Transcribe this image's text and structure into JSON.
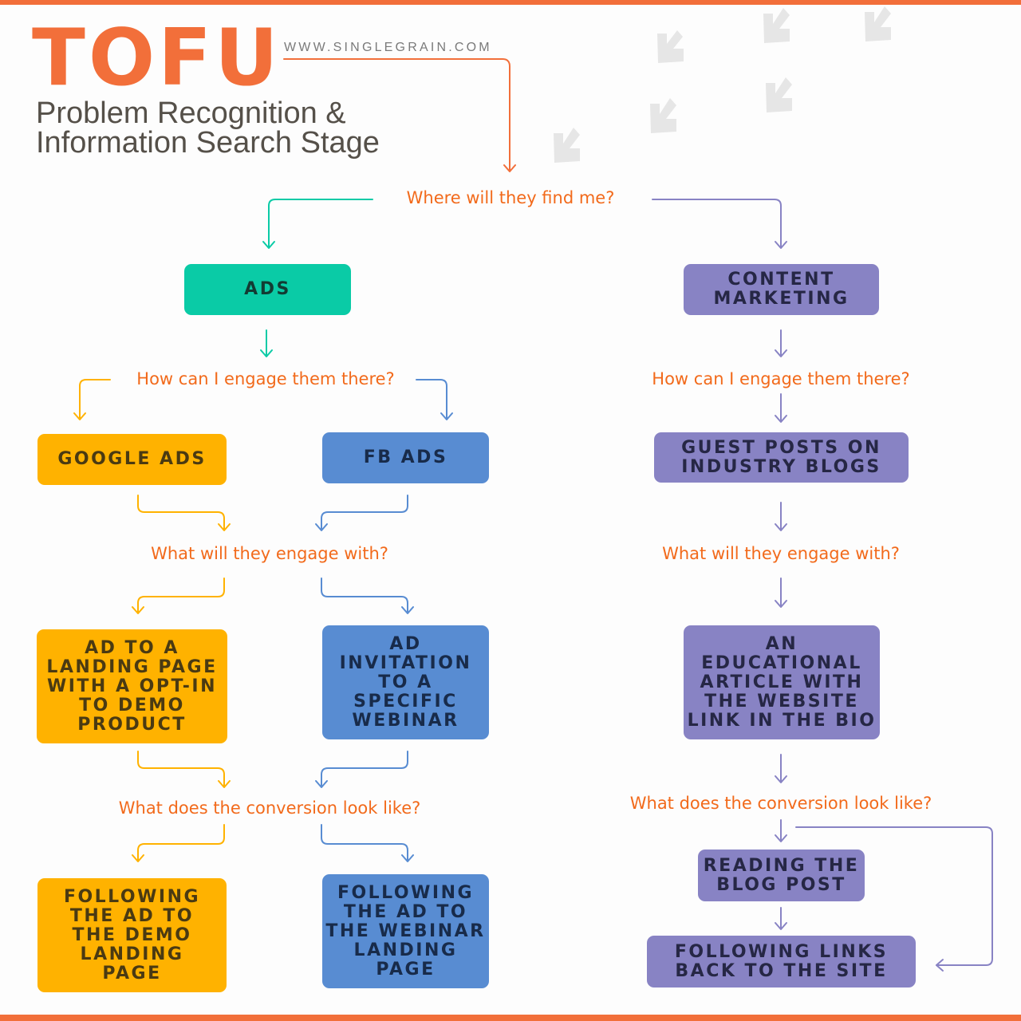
{
  "header": {
    "title": "TOFU",
    "website": "WWW.SINGLEGRAIN.COM",
    "subtitle_line1": "Problem Recognition &",
    "subtitle_line2": "Information Search Stage"
  },
  "colors": {
    "accent_orange": "#f26f3a",
    "question_orange": "#f26a1b",
    "ads_teal": "#0acba6",
    "google_yellow": "#ffb200",
    "fb_blue": "#588cd2",
    "content_purple": "#8883c4",
    "decor_arrow_gray": "#e6e6e6"
  },
  "decorations": {
    "icon": "arrow-down-left-icon",
    "count": 7
  },
  "questions": {
    "where": "Where will they find me?",
    "engage_left": "How can I engage them there?",
    "engage_right": "How can I engage them there?",
    "what_left": "What will they engage with?",
    "what_right": "What will they engage with?",
    "conversion_left": "What does the conversion look like?",
    "conversion_right": "What does the conversion look like?"
  },
  "boxes": {
    "ads": "ADS",
    "content_marketing": "CONTENT\nMARKETING",
    "google_ads": "GOOGLE ADS",
    "fb_ads": "FB ADS",
    "guest_posts": "GUEST POSTS ON\nINDUSTRY BLOGS",
    "google_engage": "AD TO A\nLANDING PAGE\nWITH A OPT-IN\nTO DEMO\nPRODUCT",
    "fb_engage": "AD\nINVITATION\nTO A\nSPECIFIC\nWEBINAR",
    "content_engage": "AN\nEDUCATIONAL\nARTICLE WITH\nTHE WEBSITE\nLINK IN THE BIO",
    "google_conversion": "FOLLOWING\nTHE AD TO\nTHE DEMO\nLANDING\nPAGE",
    "fb_conversion": "FOLLOWING\nTHE AD TO\nTHE WEBINAR\nLANDING\nPAGE",
    "content_conversion_1": "READING THE\nBLOG POST",
    "content_conversion_2": "FOLLOWING LINKS\nBACK TO THE SITE"
  }
}
